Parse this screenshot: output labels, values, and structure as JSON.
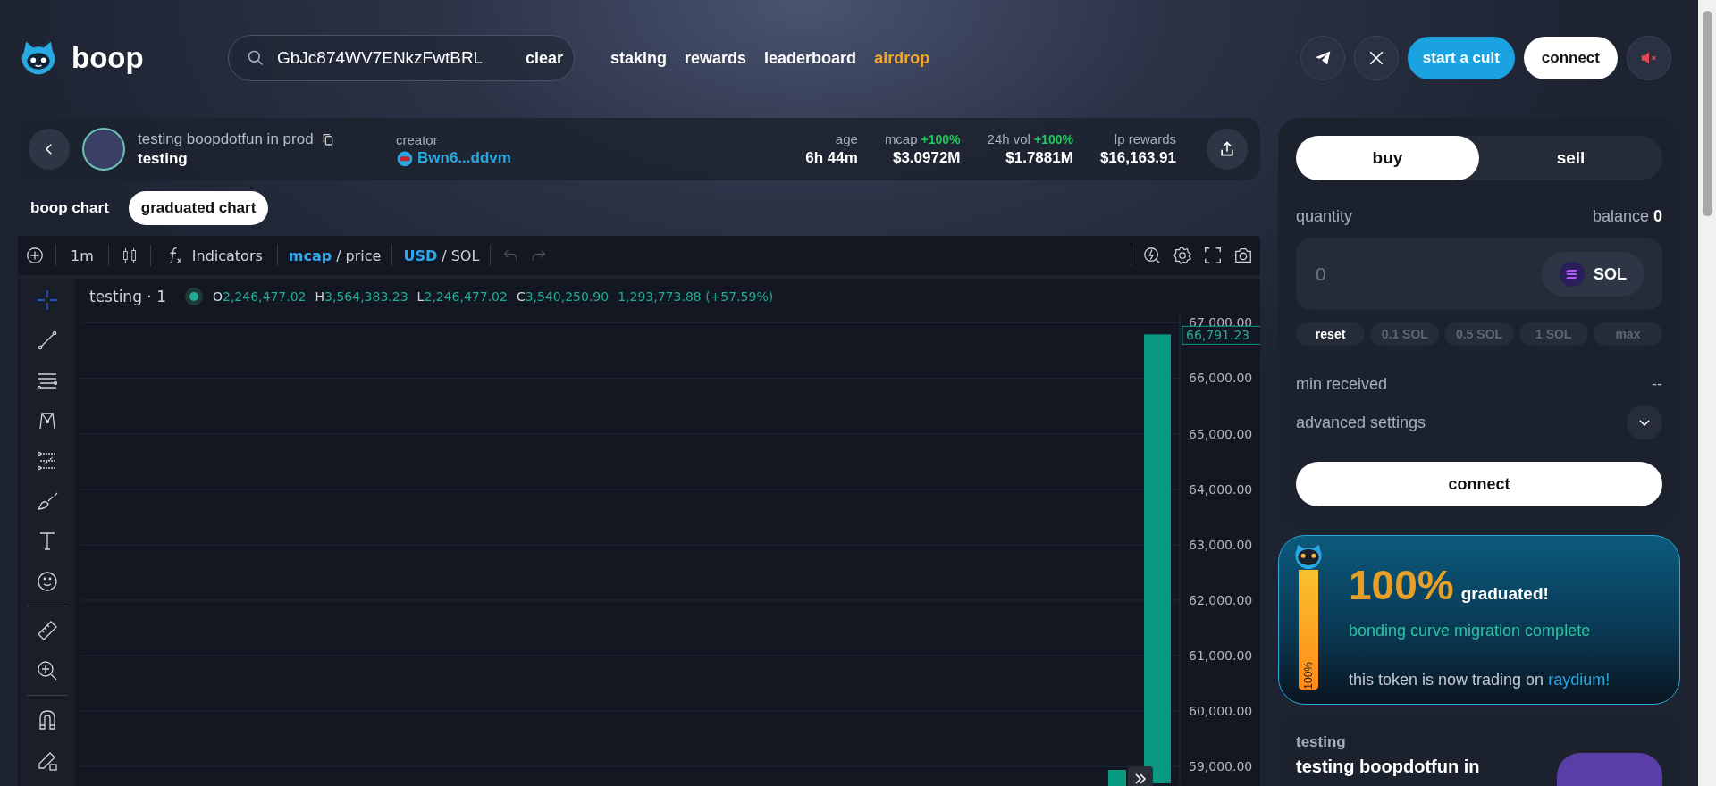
{
  "header": {
    "logo_text": "boop",
    "search": {
      "value": "GbJc874WV7ENkzFwtBRL",
      "clear": "clear"
    },
    "nav": [
      {
        "label": "staking",
        "kind": "link"
      },
      {
        "label": "rewards",
        "kind": "link"
      },
      {
        "label": "leaderboard",
        "kind": "link"
      },
      {
        "label": "airdrop",
        "kind": "promo"
      }
    ],
    "start_button": "start a cult",
    "connect_button": "connect",
    "sound": {
      "muted": true
    }
  },
  "token": {
    "name": "testing boopdotfun in prod",
    "ticker": "testing",
    "creator_label": "creator",
    "creator": "Bwn6...ddvm",
    "stats": [
      {
        "label": "age",
        "value": "6h 44m"
      },
      {
        "label": "mcap",
        "change": "+100%",
        "value": "$3.0972M"
      },
      {
        "label": "24h vol",
        "change": "+100%",
        "value": "$1.7881M"
      },
      {
        "label": "lp rewards",
        "value": "$16,163.91"
      }
    ]
  },
  "chart_tabs": [
    {
      "label": "boop chart",
      "selected": false
    },
    {
      "label": "graduated chart",
      "selected": true
    }
  ],
  "toolbar": {
    "interval": "1m",
    "indicators": "Indicators",
    "groups": [
      {
        "options": [
          {
            "label": "mcap",
            "selected": true
          },
          {
            "label": "price",
            "selected": false
          }
        ],
        "separator": "/"
      },
      {
        "options": [
          {
            "label": "USD",
            "selected": true
          },
          {
            "label": "SOL",
            "selected": false
          }
        ],
        "separator": "/"
      }
    ],
    "undo": {
      "disabled": true
    },
    "redo": {
      "disabled": true
    }
  },
  "drawing_tools": [
    {
      "selected": true
    },
    {
      "selected": false
    },
    {
      "selected": false
    },
    {
      "selected": false
    },
    {
      "selected": false
    },
    {
      "selected": false
    },
    {
      "selected": false
    },
    {
      "selected": false
    },
    {
      "selected": false
    },
    {
      "selected": false
    },
    {
      "selected": false
    },
    {
      "selected": false
    }
  ],
  "legend": {
    "title": "testing · 1",
    "ohlc": [
      {
        "key": "O",
        "value": "2,246,477.02"
      },
      {
        "key": "H",
        "value": "3,564,383.23"
      },
      {
        "key": "L",
        "value": "2,246,477.02"
      },
      {
        "key": "C",
        "value": "3,540,250.90"
      }
    ],
    "change": "1,293,773.88 (+57.59%)"
  },
  "chart": {
    "chart_data": {
      "type": "bar",
      "values": [
        66790
      ],
      "ylim": [
        58700,
        67150
      ],
      "grid": true,
      "yticks": [
        {
          "value": 67000,
          "label": "67,000.00"
        },
        {
          "value": 66000,
          "label": "66,000.00"
        },
        {
          "value": 65000,
          "label": "65,000.00"
        },
        {
          "value": 64000,
          "label": "64,000.00"
        },
        {
          "value": 63000,
          "label": "63,000.00"
        },
        {
          "value": 62000,
          "label": "62,000.00"
        },
        {
          "value": 61000,
          "label": "61,000.00"
        },
        {
          "value": 60000,
          "label": "60,000.00"
        },
        {
          "value": 59000,
          "label": "59,000.00"
        }
      ],
      "annotations": [
        "66,791.23"
      ]
    }
  },
  "trade": {
    "tabs": [
      {
        "label": "buy",
        "selected": true
      },
      {
        "label": "sell",
        "selected": false
      }
    ],
    "quantity_label": "quantity",
    "balance_label": "balance",
    "balance": "0",
    "placeholder": "0",
    "currency": "SOL",
    "presets": [
      {
        "label": "reset",
        "disabled": false
      },
      {
        "label": "0.1 SOL",
        "disabled": true
      },
      {
        "label": "0.5 SOL",
        "disabled": true
      },
      {
        "label": "1 SOL",
        "disabled": true
      },
      {
        "label": "max",
        "disabled": true
      }
    ],
    "min_received_label": "min received",
    "min_received": "--",
    "advanced_label": "advanced settings",
    "advanced_expanded": false,
    "connect": "connect"
  },
  "graduation": {
    "level": 1,
    "bar_label": "100%",
    "percent": "100%",
    "title": "graduated!",
    "subtitle": "bonding curve migration complete",
    "note": "this token is now trading on",
    "link": "raydium!"
  },
  "token_card": {
    "ticker": "testing",
    "name": "testing boopdotfun in"
  }
}
